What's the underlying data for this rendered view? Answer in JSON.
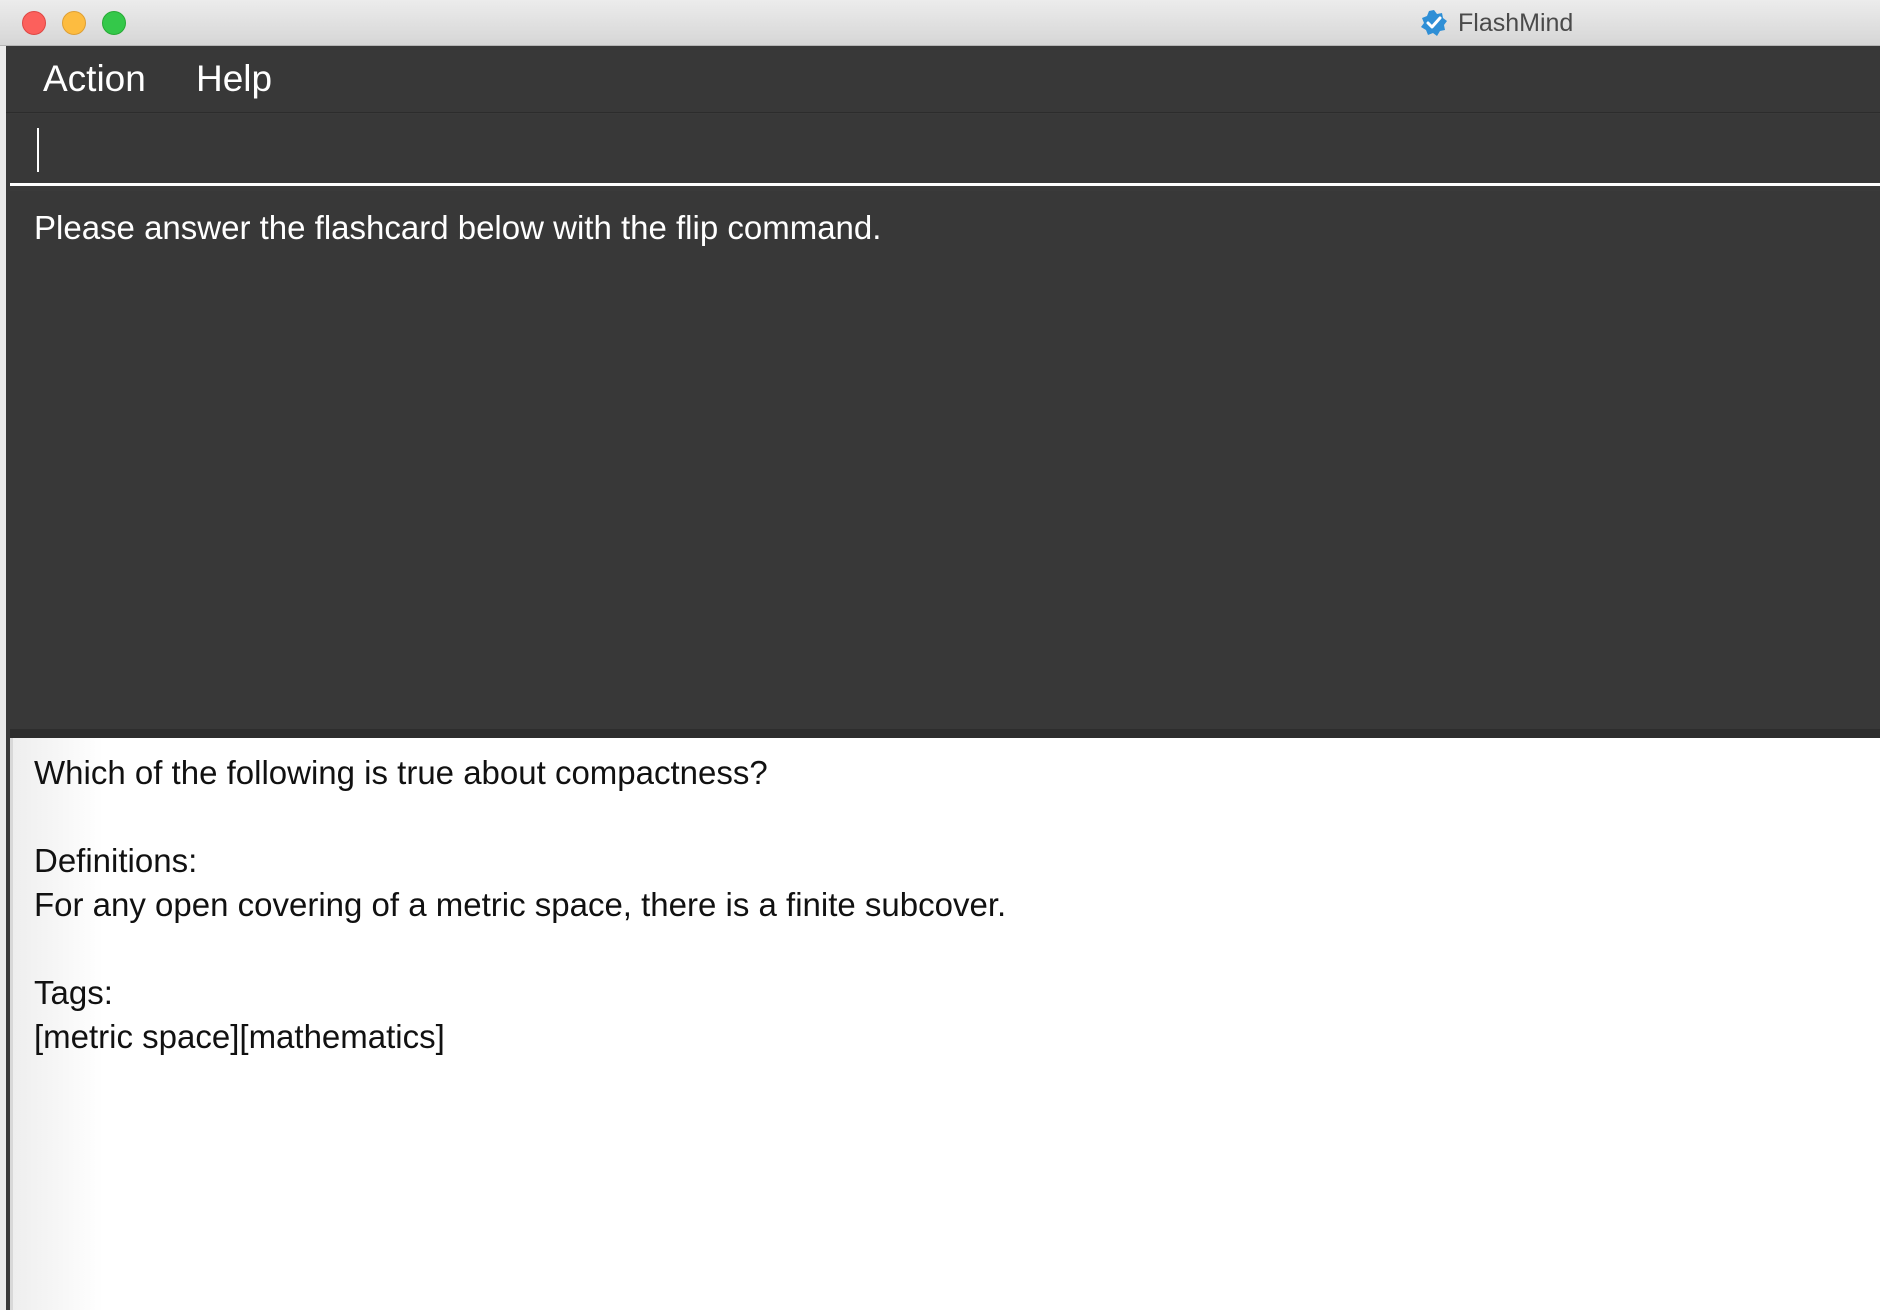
{
  "window": {
    "title": "FlashMind",
    "app_icon": "flashmind-logo-icon"
  },
  "menu": {
    "items": [
      {
        "label": "Action"
      },
      {
        "label": "Help"
      }
    ]
  },
  "command": {
    "value": "",
    "placeholder": ""
  },
  "result": {
    "message": "Please answer the flashcard below with the flip command."
  },
  "card": {
    "question": "Which of the following is true about compactness?",
    "definitions_label": "Definitions:",
    "definition": "For any open covering of a metric space, there is a finite subcover.",
    "tags_label": "Tags:",
    "tags": "[metric space][mathematics]"
  },
  "colors": {
    "background_dark": "#383838",
    "card_background": "#ffffff",
    "accent_blue": "#2f8fd6"
  }
}
